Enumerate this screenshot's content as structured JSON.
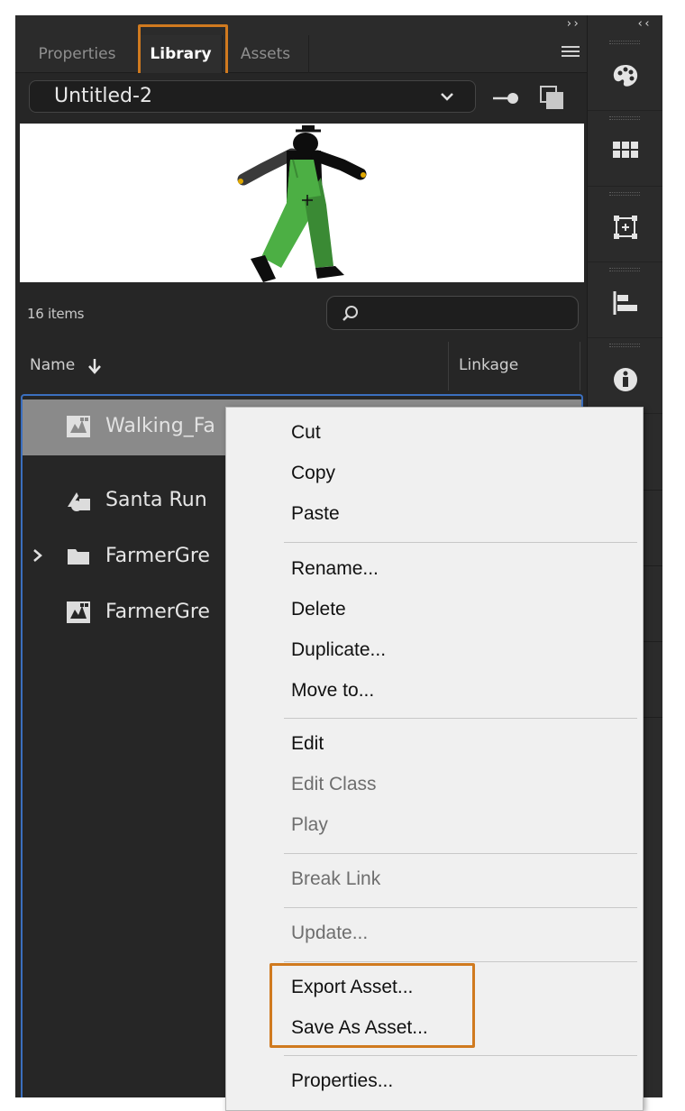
{
  "panel": {
    "tabs": [
      "Properties",
      "Library",
      "Assets"
    ],
    "active_tab": "Library",
    "document": "Untitled-2",
    "item_count": "16 items",
    "search_placeholder": "",
    "columns": {
      "name": "Name",
      "linkage": "Linkage"
    },
    "items": [
      {
        "label": "Walking_Fa",
        "icon": "movieclip-icon",
        "selected": true
      },
      {
        "label": "Santa Run",
        "icon": "graphic-icon",
        "selected": false
      },
      {
        "label": "FarmerGre",
        "icon": "folder-icon",
        "selected": false
      },
      {
        "label": "FarmerGre",
        "icon": "movieclip-icon",
        "selected": false
      }
    ]
  },
  "context_menu": {
    "group1": [
      "Cut",
      "Copy",
      "Paste"
    ],
    "group2": [
      "Rename...",
      "Delete",
      "Duplicate...",
      "Move to..."
    ],
    "group3": [
      "Edit",
      "Edit Class",
      "Play"
    ],
    "group4": [
      "Break Link"
    ],
    "group5": [
      "Update..."
    ],
    "group6": [
      "Export Asset...",
      "Save As Asset..."
    ],
    "group7": [
      "Properties..."
    ],
    "disabled": [
      "Edit Class",
      "Play",
      "Break Link",
      "Update..."
    ]
  },
  "dock_icons": [
    "palette-icon",
    "swatches-icon",
    "transform-icon",
    "align-icon",
    "info-icon"
  ],
  "colors": {
    "highlight": "#d07a1f",
    "selection_border": "#3b6fbf",
    "figure_green": "#4caf44",
    "figure_dark_green": "#3a8a34"
  }
}
